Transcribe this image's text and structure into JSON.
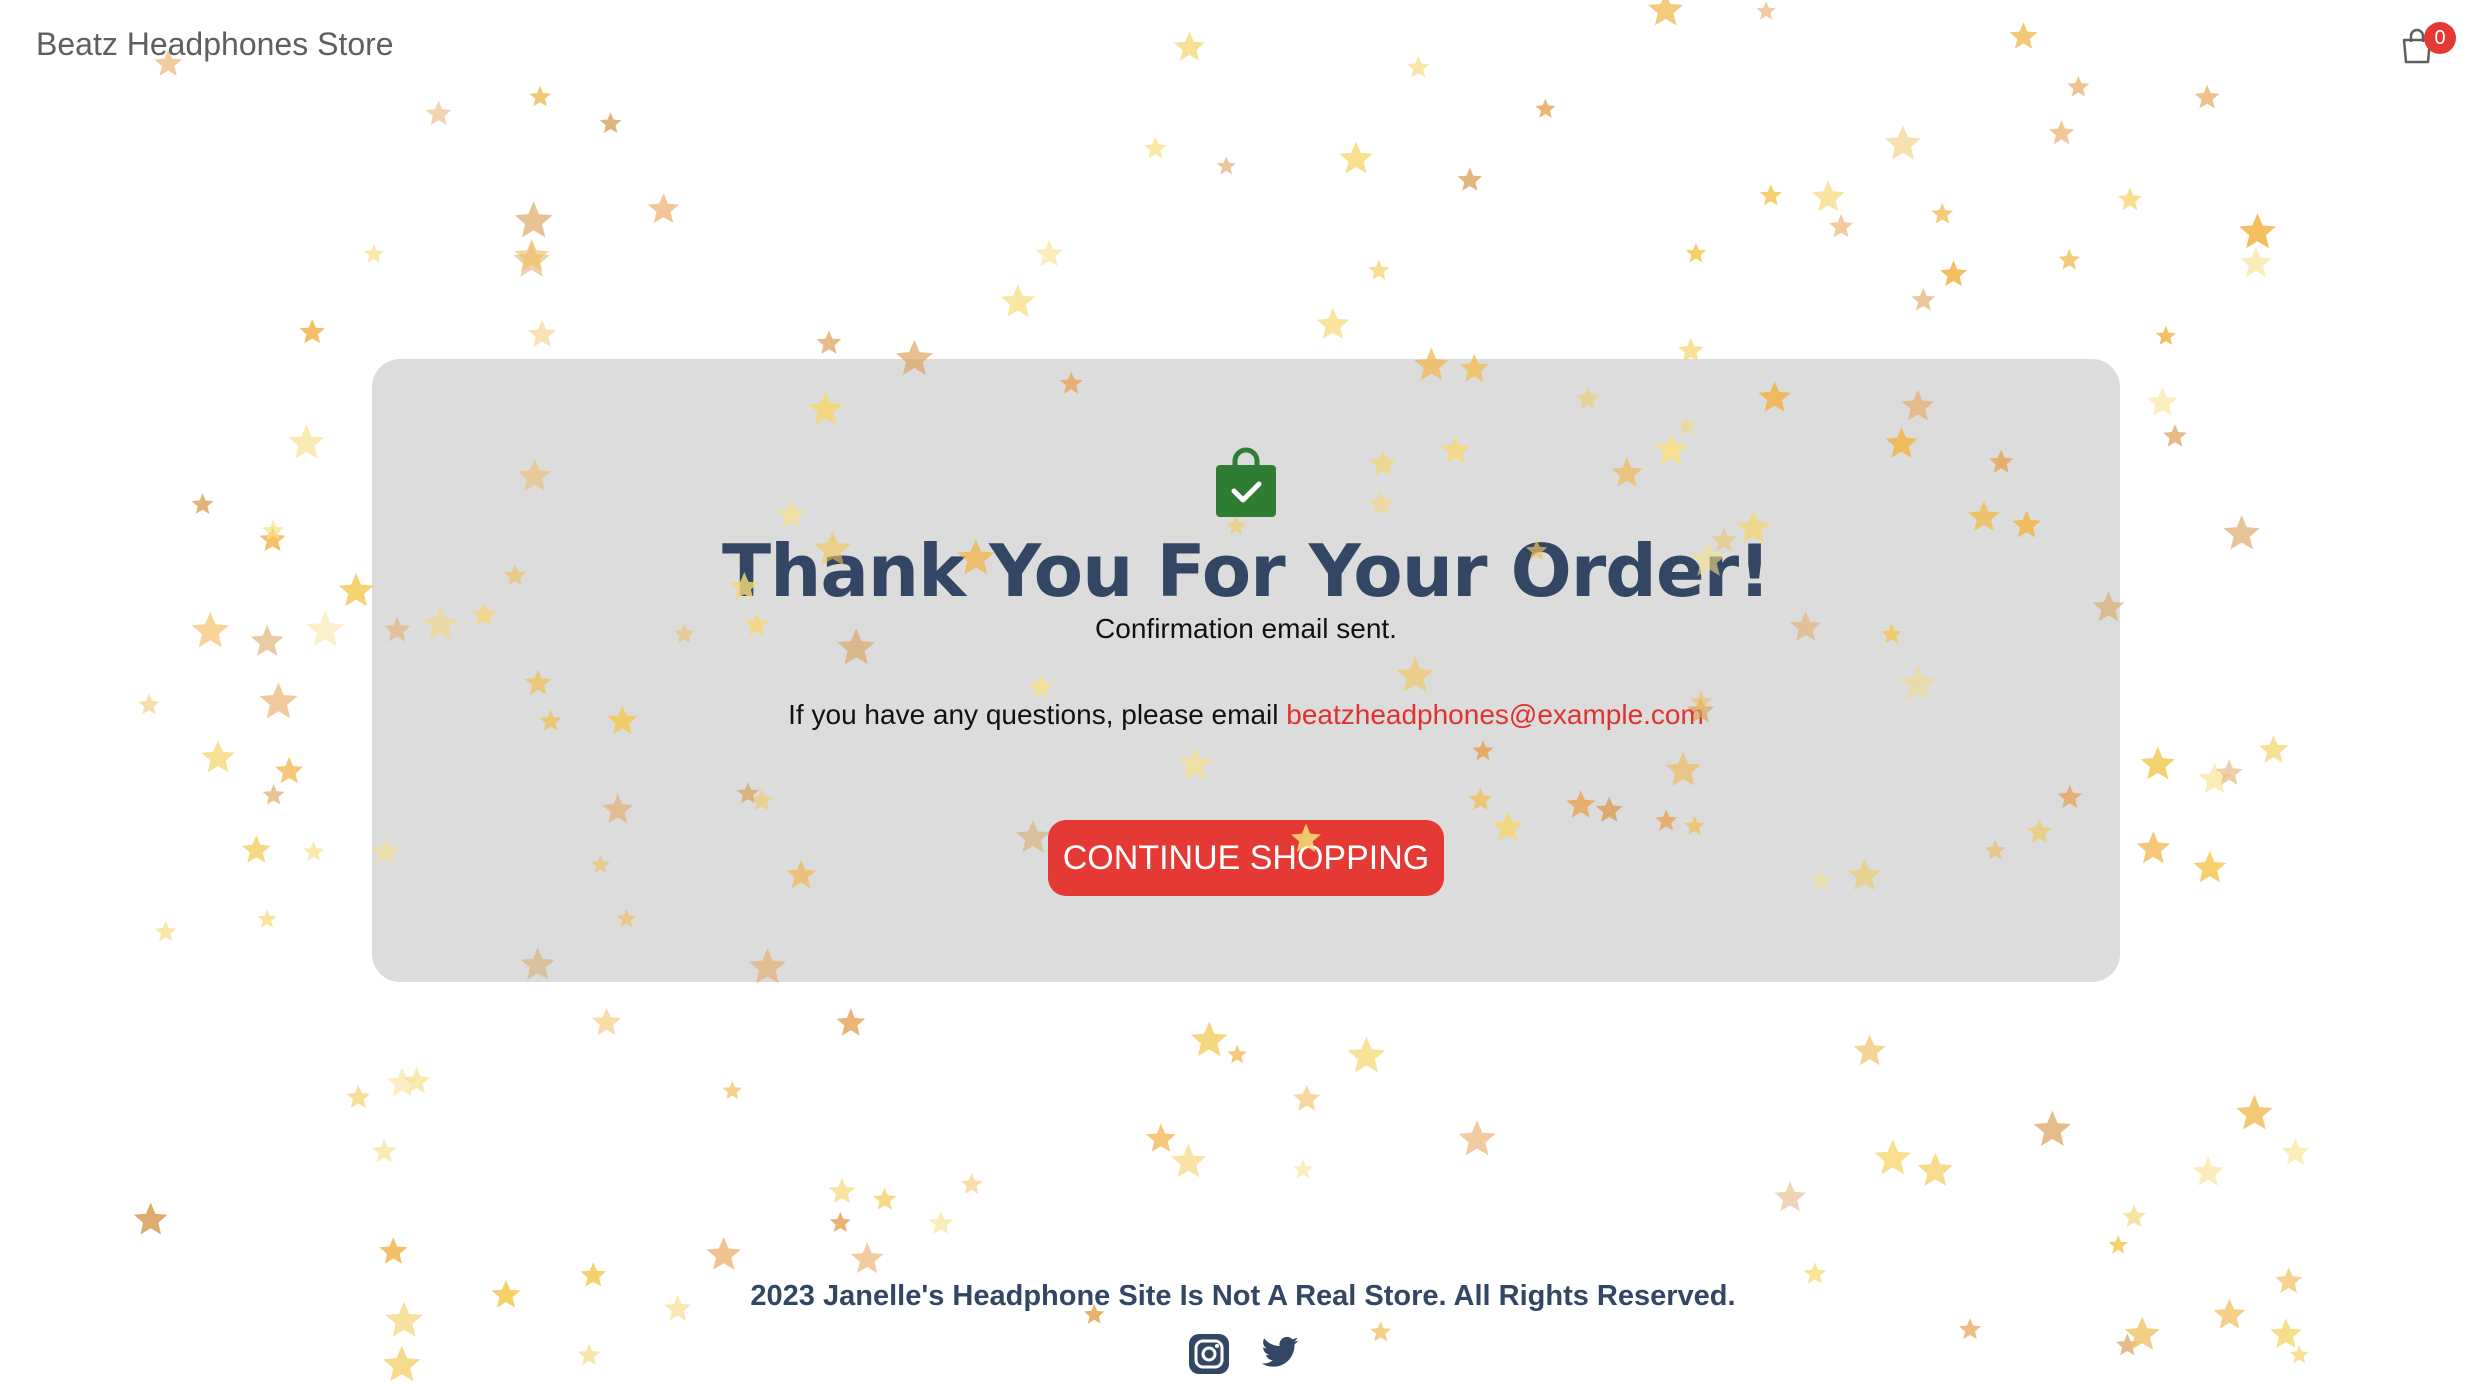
{
  "navbar": {
    "brand": "Beatz Headphones Store",
    "cart_icon": "shopping-bag-icon",
    "cart_count": "0"
  },
  "order": {
    "icon": "bag-check-icon",
    "title": "Thank You For Your Order!",
    "confirmation": "Confirmation email sent.",
    "questions_text": "If you have any questions, please email",
    "email": "beatzheadphones@example.com",
    "continue_label": "CONTINUE SHOPPING"
  },
  "footer": {
    "text": "2023 Janelle's Headphone Site Is Not A Real Store. All Rights Reserved.",
    "social_icons": [
      "instagram-icon",
      "twitter-icon"
    ]
  },
  "colors": {
    "brand_red": "#e53935",
    "heading_navy": "#334765",
    "card_gray": "#dcdcdc",
    "bag_green": "#2e7d32",
    "star_gold": "#f3c74f"
  }
}
